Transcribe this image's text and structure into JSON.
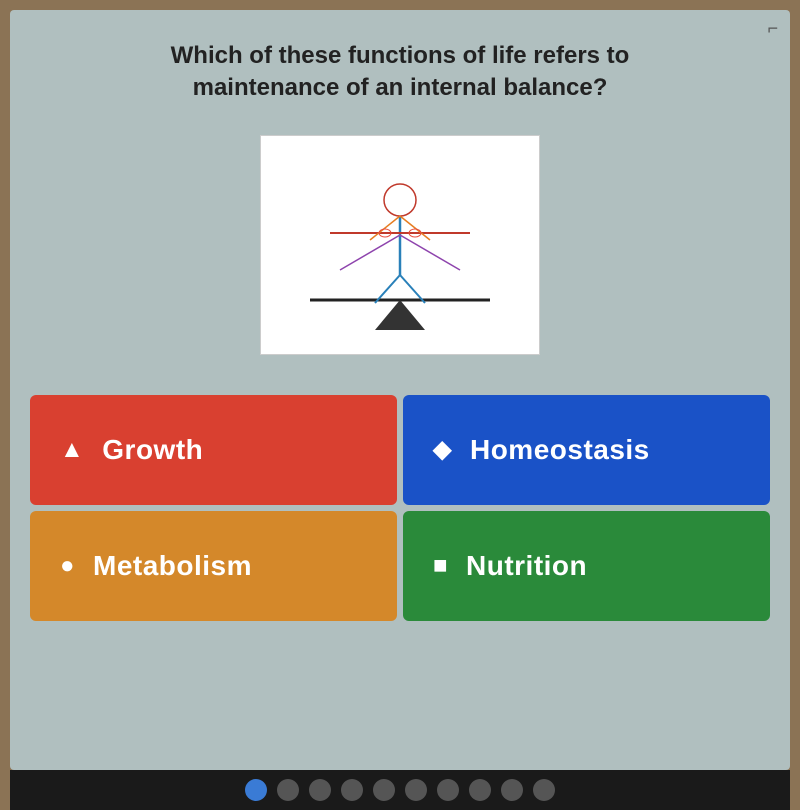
{
  "question": {
    "text": "Which of these functions of life refers to maintenance of an internal balance?"
  },
  "answers": [
    {
      "id": "growth",
      "label": "Growth",
      "icon": "▲",
      "color_class": "btn-red"
    },
    {
      "id": "homeostasis",
      "label": "Homeostasis",
      "icon": "◆",
      "color_class": "btn-blue"
    },
    {
      "id": "metabolism",
      "label": "Metabolism",
      "icon": "●",
      "color_class": "btn-orange"
    },
    {
      "id": "nutrition",
      "label": "Nutrition",
      "icon": "■",
      "color_class": "btn-green"
    }
  ],
  "corner": "⌐",
  "colors": {
    "red": "#d94030",
    "blue": "#1a52c7",
    "orange": "#d4882a",
    "green": "#2a8a3a",
    "background": "#b0bfbf"
  }
}
